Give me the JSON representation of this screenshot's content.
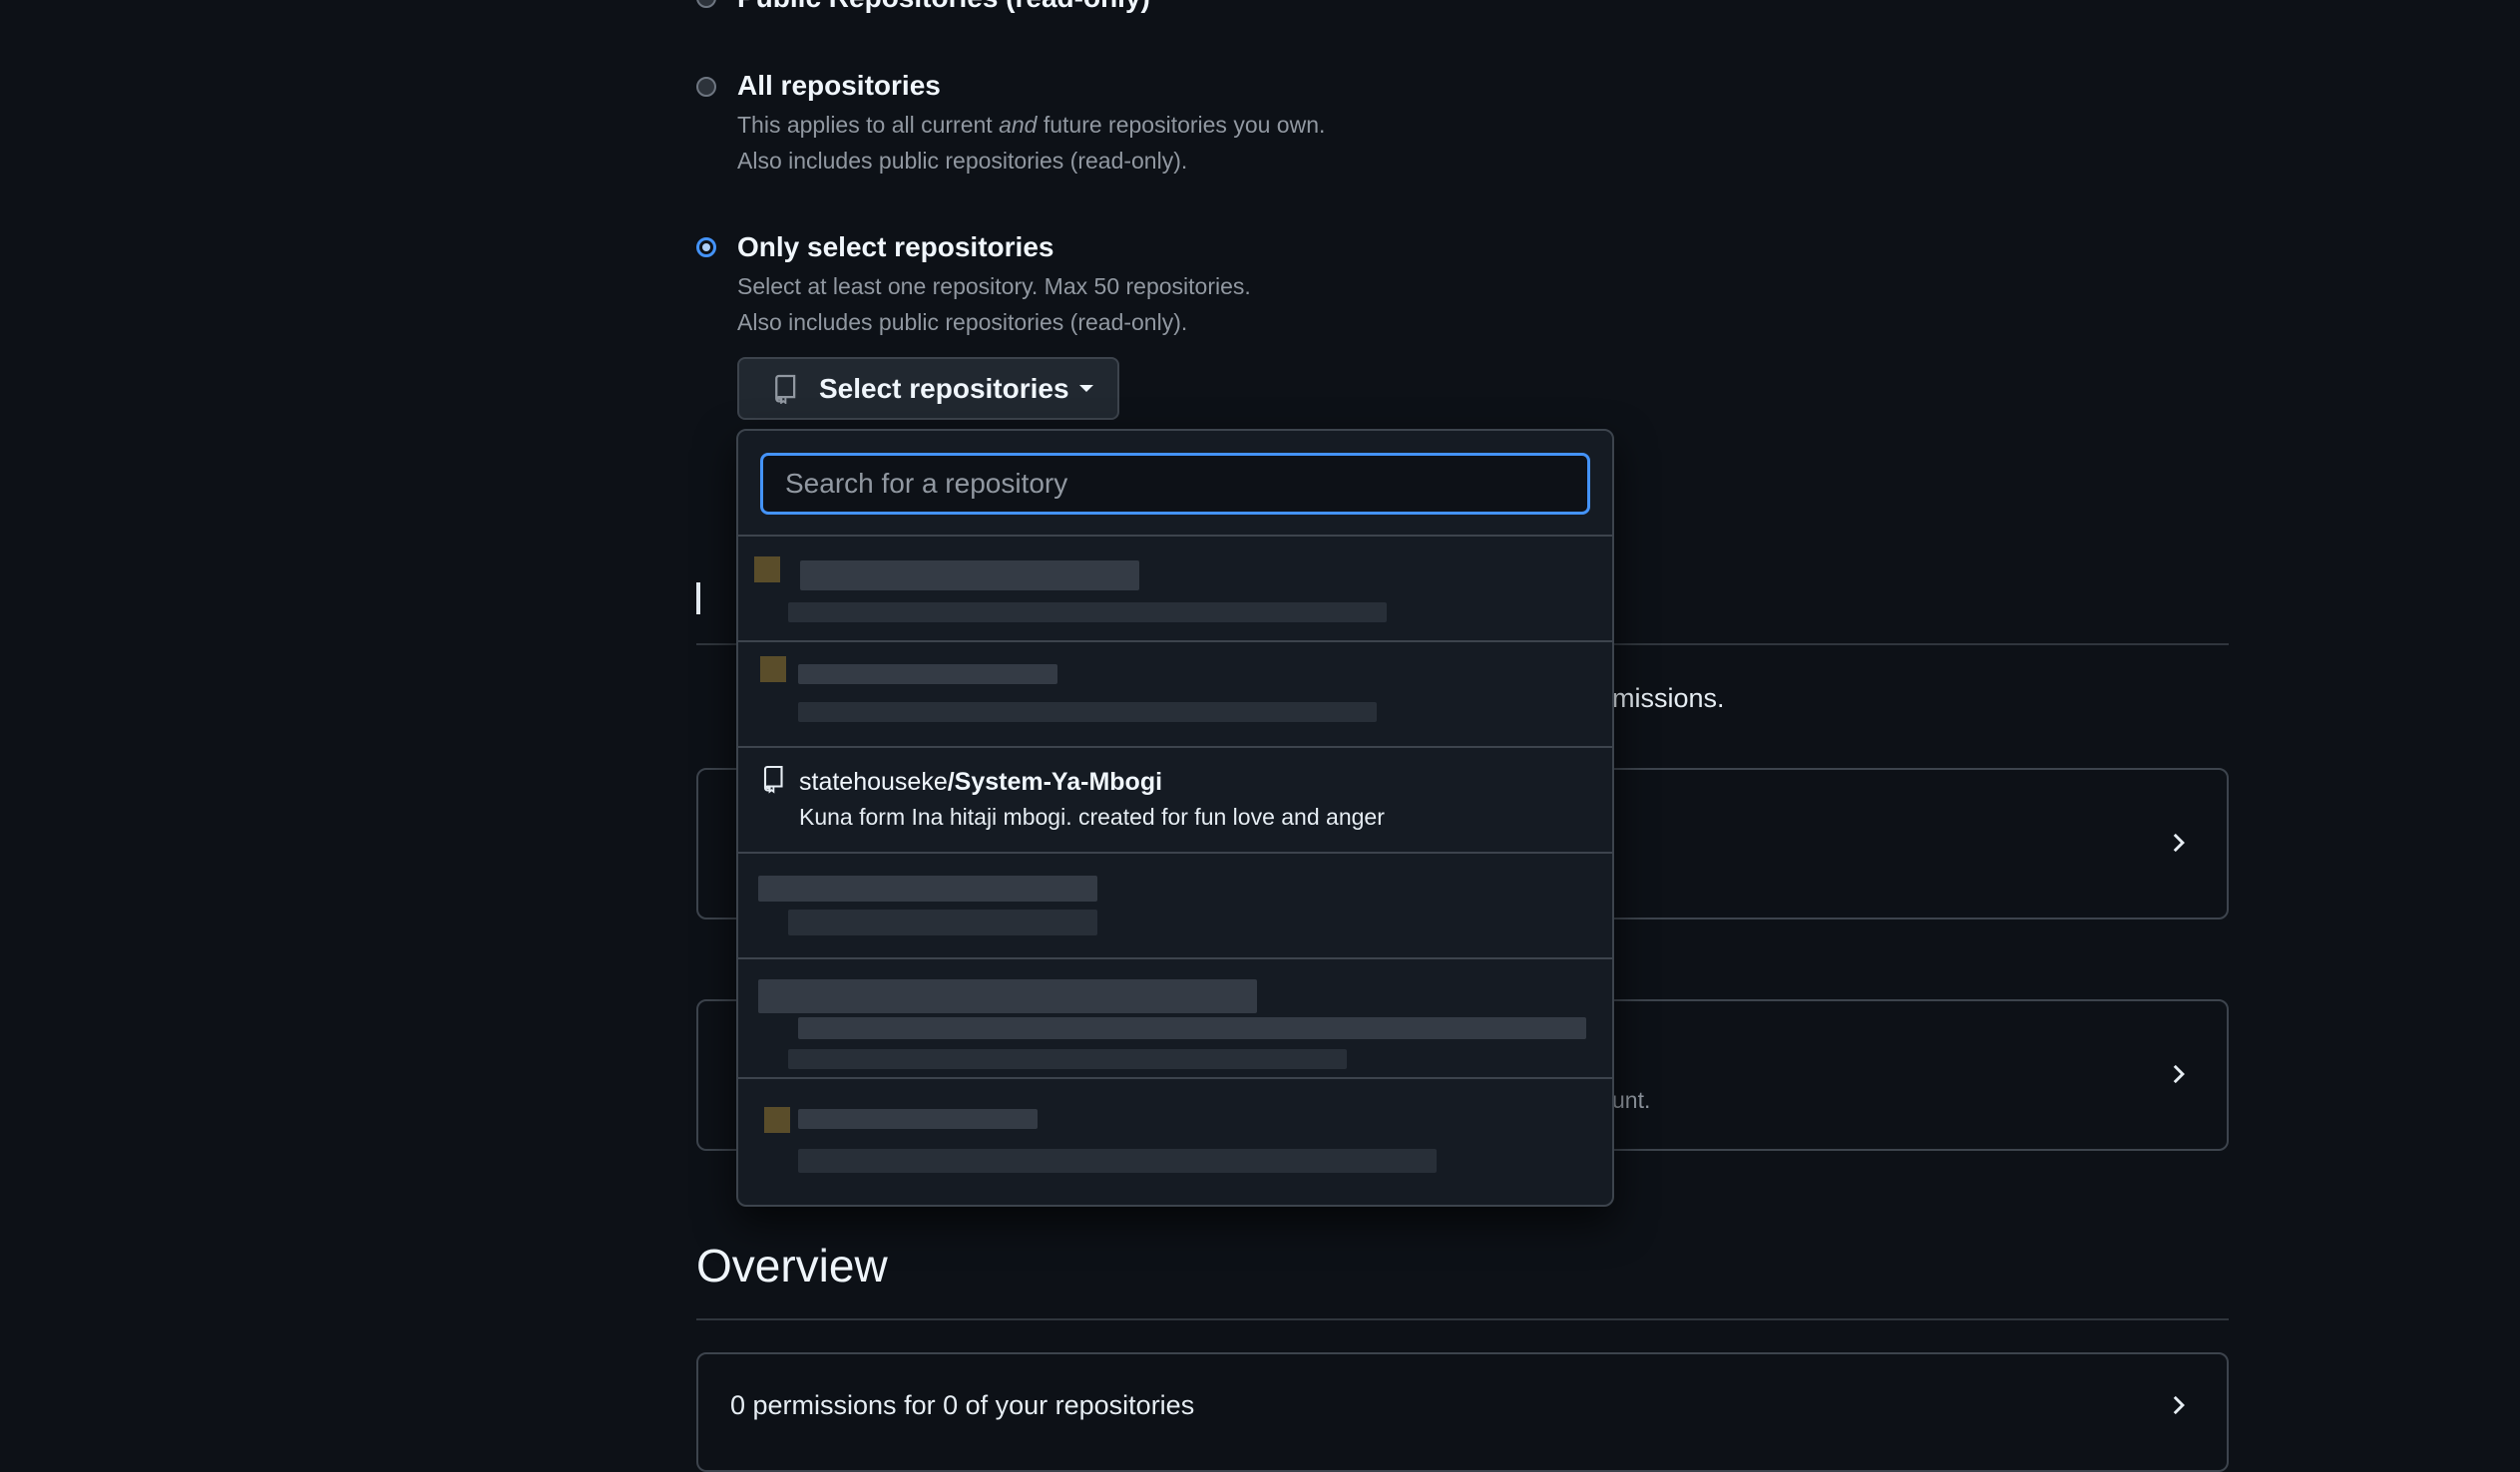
{
  "options": [
    {
      "title": "Public Repositories (read-only)",
      "checked": false
    },
    {
      "title": "All repositories",
      "desc_prefix": "This applies to all current ",
      "desc_em": "and",
      "desc_suffix": " future repositories you own.",
      "desc2": "Also includes public repositories (read-only).",
      "checked": false
    },
    {
      "title": "Only select repositories",
      "desc1": "Select at least one repository. Max 50 repositories.",
      "desc2": "Also includes public repositories (read-only).",
      "checked": true
    }
  ],
  "select_button": {
    "label": "Select repositories"
  },
  "search": {
    "placeholder": "Search for a repository"
  },
  "visible_repo": {
    "owner": "statehouseke",
    "name": "/System-Ya-Mbogi",
    "description": "Kuna form Ina hitaji mbogi. created for fun love and anger"
  },
  "background": {
    "permissions_partial": "missions.",
    "account_partial": "unt.",
    "overview_title": "Overview",
    "overview_summary": "0 permissions for 0 of your repositories"
  }
}
